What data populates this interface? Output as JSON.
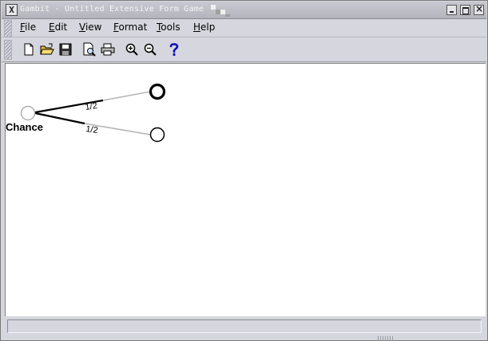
{
  "window": {
    "close_glyph": "X",
    "title": "Gambit - Untitled Extensive Form Game"
  },
  "menu": {
    "items": [
      {
        "label": "File",
        "accel": "F",
        "rest": "ile"
      },
      {
        "label": "Edit",
        "accel": "E",
        "rest": "dit"
      },
      {
        "label": "View",
        "accel": "V",
        "rest": "iew"
      },
      {
        "label": "Format",
        "accel": "F",
        "rest": "ormat"
      },
      {
        "label": "Tools",
        "accel": "T",
        "rest": "ools"
      },
      {
        "label": "Help",
        "accel": "H",
        "rest": "elp"
      }
    ]
  },
  "toolbar": {
    "buttons": [
      {
        "name": "new-file-icon",
        "action": "new"
      },
      {
        "name": "open-folder-icon",
        "action": "open"
      },
      {
        "name": "save-disk-icon",
        "action": "save"
      },
      {
        "name": "print-preview-icon",
        "action": "print preview"
      },
      {
        "name": "print-icon",
        "action": "print"
      },
      {
        "name": "zoom-in-icon",
        "action": "zoom in"
      },
      {
        "name": "zoom-out-icon",
        "action": "zoom out"
      },
      {
        "name": "help-icon",
        "action": "help"
      }
    ]
  },
  "game_tree": {
    "root": {
      "label": "Chance",
      "type": "chance"
    },
    "branches": [
      {
        "probability": "1/2",
        "terminal_selected": true
      },
      {
        "probability": "1/2",
        "terminal_selected": false
      }
    ]
  },
  "status": {
    "text": ""
  },
  "colors": {
    "chance_node": "#b0b0b0",
    "branch_black": "#000000",
    "branch_gray": "#b4b4b4",
    "help_icon": "#1010c0"
  }
}
